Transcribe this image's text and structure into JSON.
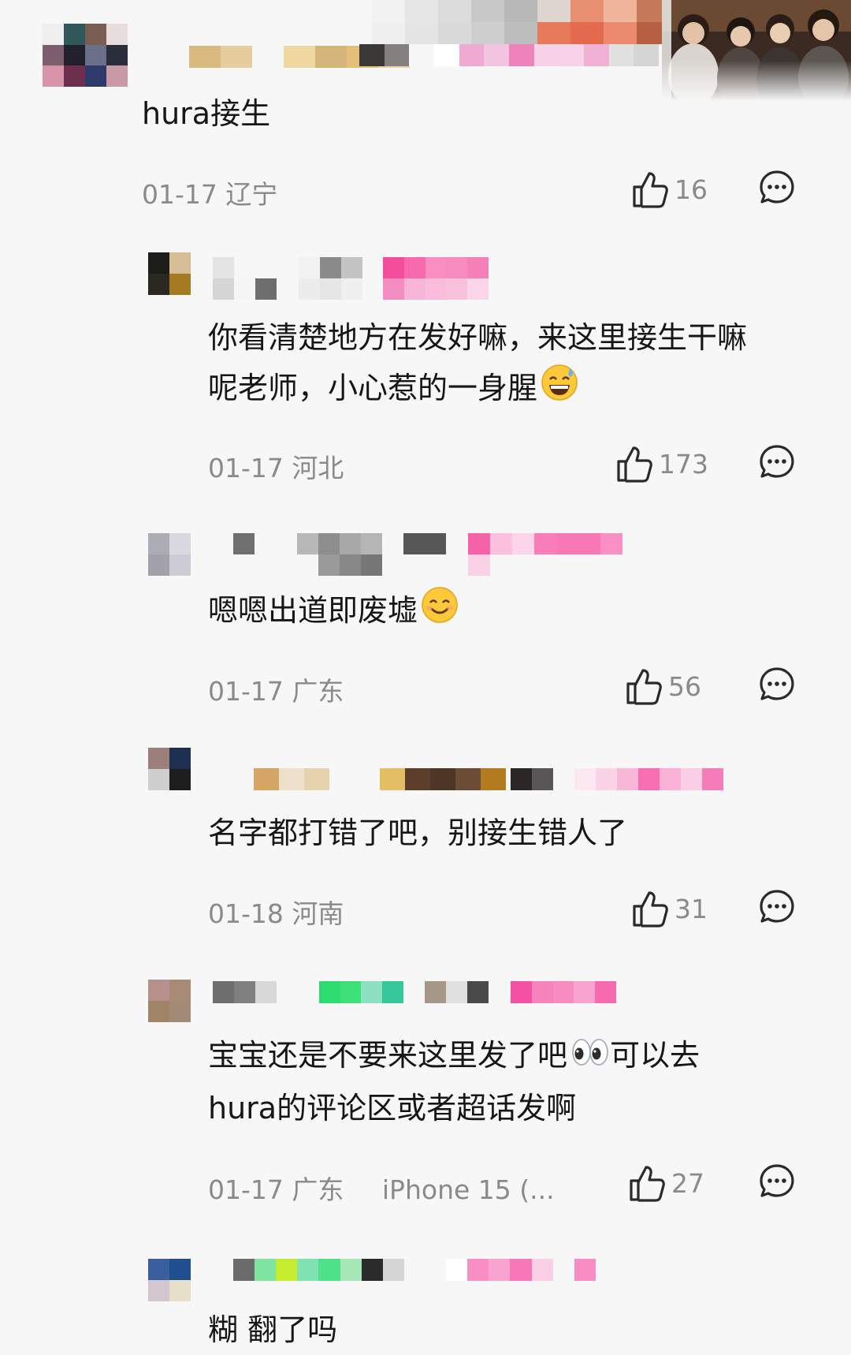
{
  "comments": [
    {
      "text_lines": [
        "hura接生"
      ],
      "date": "01-17",
      "location": "辽宁",
      "likes": "16",
      "emoji": ""
    },
    {
      "text_lines": [
        "你看清楚地方在发好嘛，来这里接生干嘛",
        "呢老师，小心惹的一身腥"
      ],
      "date": "01-17",
      "location": "河北",
      "likes": "173",
      "emoji": "sweat-smile"
    },
    {
      "text_lines": [
        "嗯嗯出道即废墟"
      ],
      "date": "01-17",
      "location": "广东",
      "likes": "56",
      "emoji": "smile"
    },
    {
      "text_lines": [
        "名字都打错了吧，别接生错人了"
      ],
      "date": "01-18",
      "location": "河南",
      "likes": "31",
      "emoji": ""
    },
    {
      "text_lines": [
        "宝宝还是不要来这里发了吧",
        "hura的评论区或者超话发啊"
      ],
      "inline_after_line1": "可以去",
      "date": "01-17",
      "location": "广东",
      "device": "iPhone 15 (...",
      "likes": "27",
      "emoji": "eyes"
    },
    {
      "text_lines": [
        "糊    翻了吗"
      ]
    }
  ],
  "colors": {
    "text": "#161616",
    "meta": "#8a8a8a",
    "background": "#f7f7f7"
  }
}
